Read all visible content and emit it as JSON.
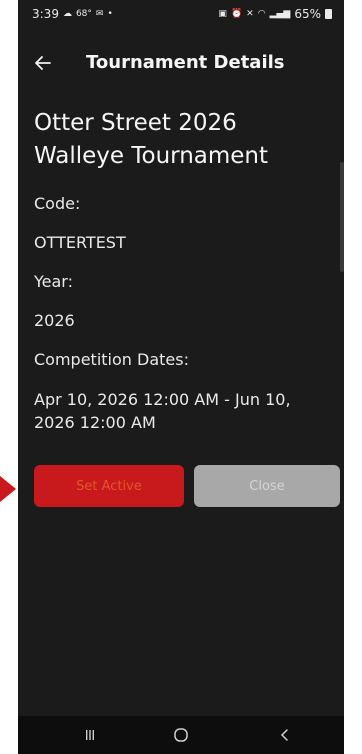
{
  "status_bar": {
    "time": "3:39",
    "temperature": "68°",
    "battery": "65%"
  },
  "app_bar": {
    "title": "Tournament Details"
  },
  "tournament": {
    "name": "Otter Street 2026 Walleye Tournament",
    "code_label": "Code:",
    "code_value": "OTTERTEST",
    "year_label": "Year:",
    "year_value": "2026",
    "dates_label": "Competition Dates:",
    "dates_value": "Apr 10, 2026 12:00 AM - Jun 10, 2026 12:00 AM"
  },
  "actions": {
    "set_active_label": "Set Active",
    "close_label": "Close"
  },
  "colors": {
    "background": "#1b1b1b",
    "set_active_bg": "#c8191c",
    "close_bg": "#a8a8a8",
    "pointer_arrow": "#c8191c"
  },
  "icons": {
    "back": "arrow-left-icon",
    "pointer": "arrow-right-icon",
    "nav_recents": "recents-icon",
    "nav_home": "home-circle-icon",
    "nav_back": "chevron-left-icon"
  }
}
